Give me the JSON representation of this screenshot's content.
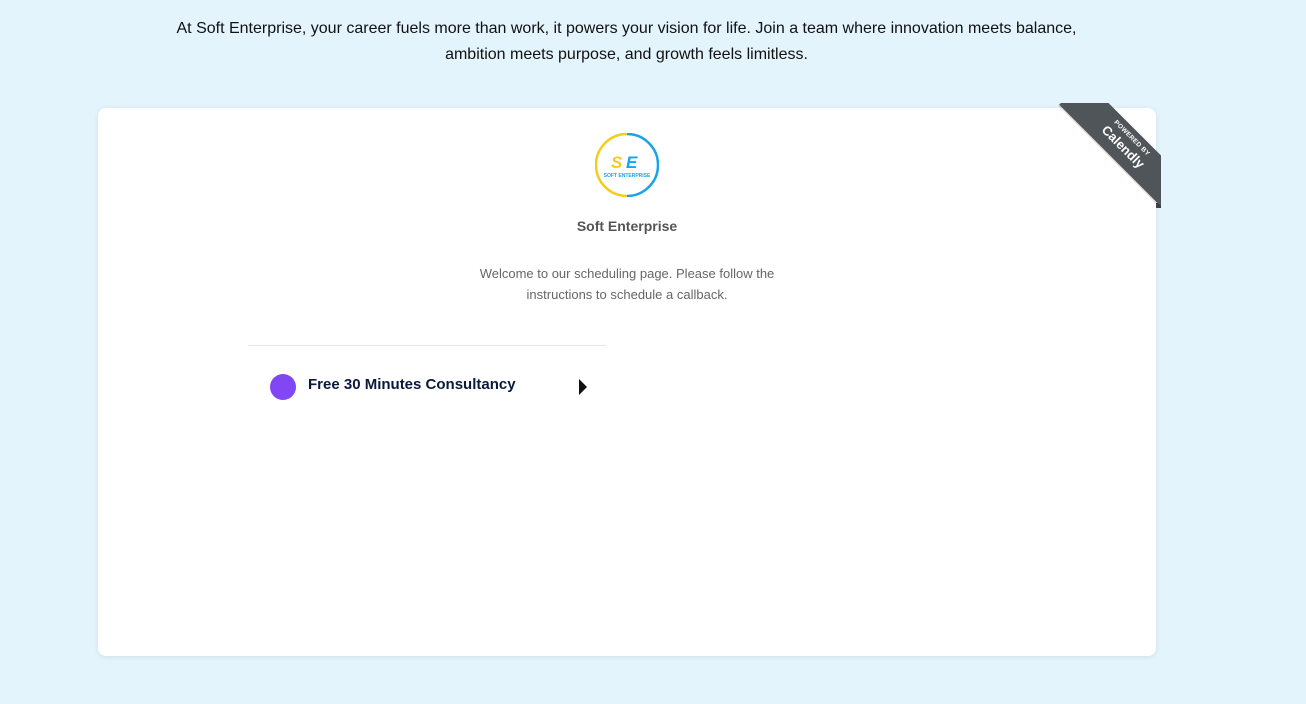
{
  "intro": {
    "text": "At Soft Enterprise, your career fuels more than work, it powers your vision for life. Join a team where innovation meets balance, ambition meets purpose, and growth feels limitless."
  },
  "org": {
    "logo_text_main": "SE",
    "logo_text_sub": "SOFT ENTERPRISE",
    "name": "Soft Enterprise",
    "welcome": "Welcome to our scheduling page. Please follow the instructions to schedule a callback."
  },
  "events": [
    {
      "label": "Free 30 Minutes Consultancy",
      "color": "#8247f5"
    }
  ],
  "badge": {
    "line1": "POWERED BY",
    "line2": "Calendly"
  },
  "colors": {
    "background": "#e3f4fc",
    "logo_yellow": "#f5cc1a",
    "logo_blue": "#1aa3e8"
  }
}
